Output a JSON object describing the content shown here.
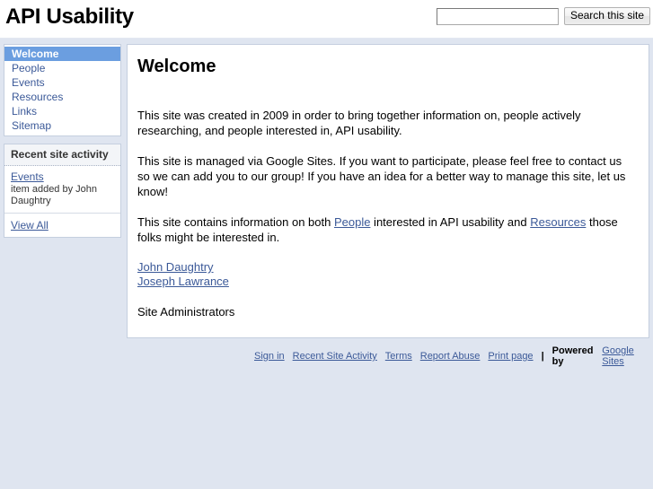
{
  "header": {
    "site_title": "API Usability",
    "search": {
      "value": "",
      "placeholder": "",
      "button_label": "Search this site"
    }
  },
  "sidebar": {
    "nav": {
      "items": [
        {
          "label": "Welcome",
          "selected": true
        },
        {
          "label": "People",
          "selected": false
        },
        {
          "label": "Events",
          "selected": false
        },
        {
          "label": "Resources",
          "selected": false
        },
        {
          "label": "Links",
          "selected": false
        },
        {
          "label": "Sitemap",
          "selected": false
        }
      ]
    },
    "activity": {
      "title": "Recent site activity",
      "entry_link": "Events",
      "entry_meta": "item added by John Daughtry",
      "view_all": "View All"
    }
  },
  "content": {
    "title": "Welcome",
    "paragraph1": "This site was created in 2009 in order to bring together information on, people actively researching, and people interested in, API usability.",
    "paragraph2": "This site is managed via Google Sites. If you want to participate, please feel free to contact us so we can add you to our group! If you have an idea for a better way to manage this site, let us know!",
    "paragraph3": {
      "before": "This site contains information on both ",
      "link1": "People",
      "middle": " interested in API usability and ",
      "link2": "Resources",
      "after": " those folks might be interested in."
    },
    "admins": {
      "person1": "John Daughtry",
      "person2": "Joseph Lawrance",
      "label": "Site Administrators"
    }
  },
  "footer": {
    "links": [
      "Sign in",
      "Recent Site Activity",
      "Terms",
      "Report Abuse",
      "Print page"
    ],
    "separator": "|",
    "powered_by": "Powered by",
    "provider": "Google Sites"
  },
  "colors": {
    "page_background": "#dfe5f0",
    "selected_nav": "#6b9ee0",
    "link": "#3b5998",
    "box_border": "#c5cfdf"
  }
}
